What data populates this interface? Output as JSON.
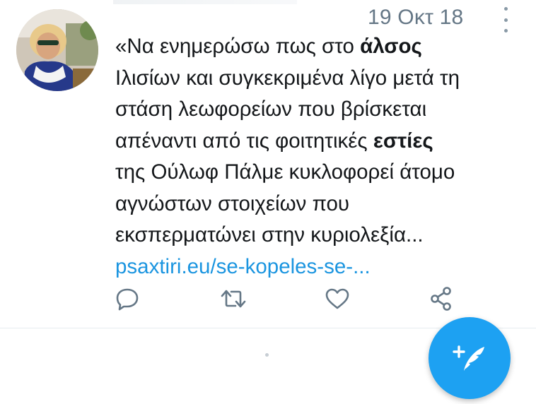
{
  "tweet": {
    "timestamp": "19 Οκτ 18",
    "text_lines": [
      {
        "before": "«Να ενημερώσω πως στο ",
        "bold": "άλσος",
        "after": ""
      },
      {
        "before": "Ιλισίων και συγκεκριμένα λίγο μετά τη",
        "bold": "",
        "after": ""
      },
      {
        "before": "στάση λεωφορείων που βρίσκεται",
        "bold": "",
        "after": ""
      },
      {
        "before": "απέναντι από τις φοιτητικές ",
        "bold": "εστίες",
        "after": ""
      },
      {
        "before": "της Ούλωφ Πάλμε κυκλοφορεί άτομο",
        "bold": "",
        "after": ""
      },
      {
        "before": "αγνώστων στοιχείων που",
        "bold": "",
        "after": ""
      },
      {
        "before": "εκσπερματώνει στην κυριολεξία...",
        "bold": "",
        "after": ""
      }
    ],
    "link": "psaxtiri.eu/se-kopeles-se-..."
  },
  "icons": {
    "reply": "reply-icon",
    "retweet": "retweet-icon",
    "like": "heart-icon",
    "share": "share-icon",
    "more": "more-vertical-icon",
    "compose": "compose-tweet-icon"
  },
  "colors": {
    "accent": "#1da1f2",
    "link": "#1b95e0",
    "text": "#14171a",
    "secondary": "#657786",
    "icon": "#657786"
  }
}
